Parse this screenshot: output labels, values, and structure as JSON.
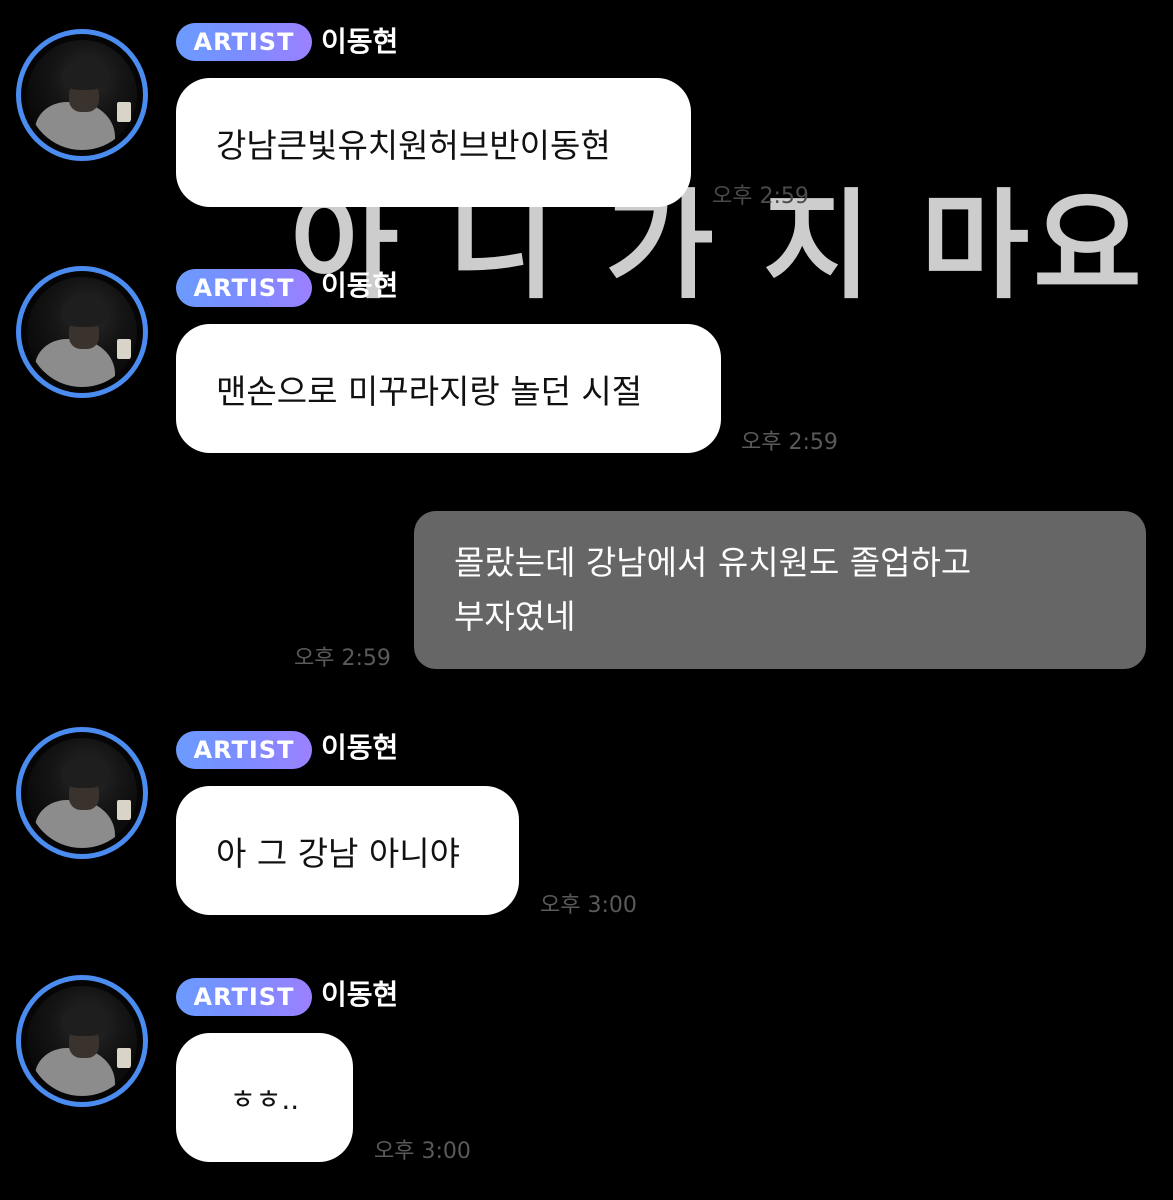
{
  "background_overlay_text": "아 니 가 지 마요",
  "messages": [
    {
      "badge": "ARTIST",
      "sender": "이동현",
      "text": "강남큰빛유치원허브반이동현",
      "time": "오후 2:59"
    },
    {
      "badge": "ARTIST",
      "sender": "이동현",
      "text": "맨손으로 미꾸라지랑 놀던 시절",
      "time": "오후 2:59"
    },
    {
      "line1": "몰랐는데 강남에서 유치원도 졸업하고",
      "line2": "부자였네",
      "time": "오후 2:59"
    },
    {
      "badge": "ARTIST",
      "sender": "이동현",
      "text": "아 그 강남 아니야",
      "time": "오후 3:00"
    },
    {
      "badge": "ARTIST",
      "sender": "이동현",
      "text": "ㅎㅎ..",
      "time": "오후 3:00"
    }
  ],
  "colors": {
    "background": "#000000",
    "avatar_ring": "#4a8cf0",
    "badge_gradient_start": "#6b9bff",
    "badge_gradient_end": "#9b80ff",
    "artist_bubble": "#ffffff",
    "fan_bubble": "#666666",
    "timestamp": "#5a5a5a"
  }
}
